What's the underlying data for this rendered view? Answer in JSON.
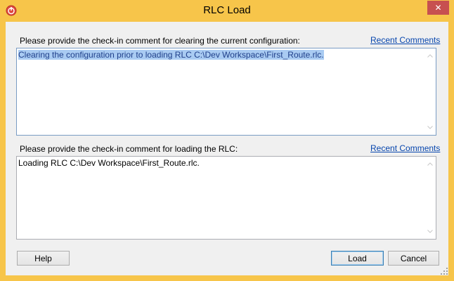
{
  "window": {
    "title": "RLC Load",
    "close_label": "✕"
  },
  "colors": {
    "frame": "#f7c54a",
    "client": "#f0f0f0",
    "link": "#0645ad",
    "selection": "#a9cbf2",
    "close_button": "#c75050"
  },
  "section1": {
    "label": "Please provide the check-in comment for clearing the current configuration:",
    "link": "Recent Comments",
    "text": "Clearing the configuration prior to loading RLC C:\\Dev Workspace\\First_Route.rlc."
  },
  "section2": {
    "label": "Please provide the check-in comment for loading the RLC:",
    "link": "Recent Comments",
    "text": "Loading RLC C:\\Dev Workspace\\First_Route.rlc."
  },
  "buttons": {
    "help": "Help",
    "load": "Load",
    "cancel": "Cancel"
  },
  "icons": {
    "app": "power-icon",
    "scroll_up": "chevron-up-icon",
    "scroll_down": "chevron-down-icon",
    "grip": "resize-grip-icon"
  }
}
